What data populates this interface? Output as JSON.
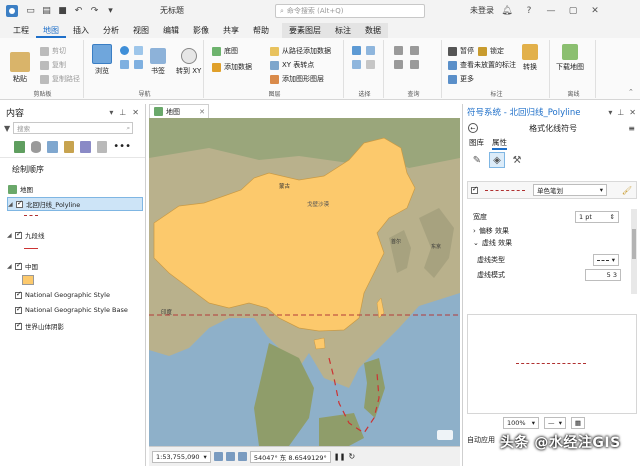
{
  "titlebar": {
    "document_title": "无标题",
    "search_placeholder": "命令搜索 (Alt+Q)",
    "signin": "未登录",
    "controls": {
      "minimize": "—",
      "maximize": "▢",
      "close": "✕"
    }
  },
  "ribbon_tabs": [
    "工程",
    "地图",
    "插入",
    "分析",
    "视图",
    "编辑",
    "影像",
    "共享",
    "帮助"
  ],
  "active_tab": "地图",
  "context_tabs": [
    "要素图层",
    "标注",
    "数据"
  ],
  "ribbon": {
    "clipboard": {
      "paste": "粘贴",
      "cut": "剪切",
      "copy": "复制",
      "copy_path": "复制路径",
      "label": "剪贴板"
    },
    "navigate": {
      "explore": "浏览",
      "bookmarks": "书签",
      "goto": "转到 XY",
      "label": "导航"
    },
    "layer": {
      "basemap": "底图",
      "add_data": "添加数据",
      "add_data_from_path": "从路径添加数据",
      "xy_to_point": "XY 表转点",
      "add_graphics_layer": "添加图形图层",
      "label": "图层"
    },
    "selection": {
      "label": "选择"
    },
    "inquiry": {
      "label": "查询"
    },
    "labeling": {
      "pause": "暂停",
      "lock": "锁定",
      "view_unplaced": "查看未放置的标注",
      "more": "更多",
      "convert": "转换",
      "label": "标注"
    },
    "offline": {
      "download_map": "下载地图",
      "label": "离线"
    }
  },
  "contents": {
    "title": "内容",
    "search_placeholder": "搜索",
    "drawing_order": "绘制顺序",
    "map_name": "地图",
    "layers": [
      {
        "name": "北回归线_Polyline",
        "checked": true,
        "expanded": true,
        "symbol": "dashed-red-line"
      },
      {
        "name": "九段线",
        "checked": true,
        "expanded": true,
        "symbol": "solid-red-line"
      },
      {
        "name": "中国",
        "checked": true,
        "expanded": true,
        "symbol": "orange-fill"
      },
      {
        "name": "National Geographic Style",
        "checked": true,
        "expanded": false,
        "symbol": ""
      },
      {
        "name": "National Geographic Style Base",
        "checked": true,
        "expanded": false,
        "symbol": ""
      },
      {
        "name": "世界山体阴影",
        "checked": true,
        "expanded": false,
        "symbol": ""
      }
    ]
  },
  "map": {
    "tab_label": "地图",
    "labels": {
      "mongolia": "蒙古",
      "gobi": "戈壁沙漠",
      "india": "印度",
      "seoul": "首尔",
      "tokyo": "东京"
    },
    "scale": "1:53,755,090",
    "coordinates": "54047° 东  8.6549129°",
    "colors": {
      "china_fill": "#fcc96c",
      "tropic_line": "#b23a3a",
      "ocean": "#8eb0c9"
    }
  },
  "symbology": {
    "title": "符号系统 - 北回归线_Polyline",
    "subtitle": "格式化线符号",
    "tabs": [
      "图库",
      "属性"
    ],
    "active_tab": "属性",
    "symbol_type": "单色笔划",
    "width_label": "宽度",
    "width_value": "1 pt",
    "offset_section": "偏移 效果",
    "dash_section": "虚线 效果",
    "dash_type_label": "虚线类型",
    "dash_pattern_label": "虚线模式",
    "dash_pattern_value": "5 3",
    "zoom": "100%",
    "auto_apply": "自动应用"
  },
  "watermark": "头条 @水经注GIS"
}
